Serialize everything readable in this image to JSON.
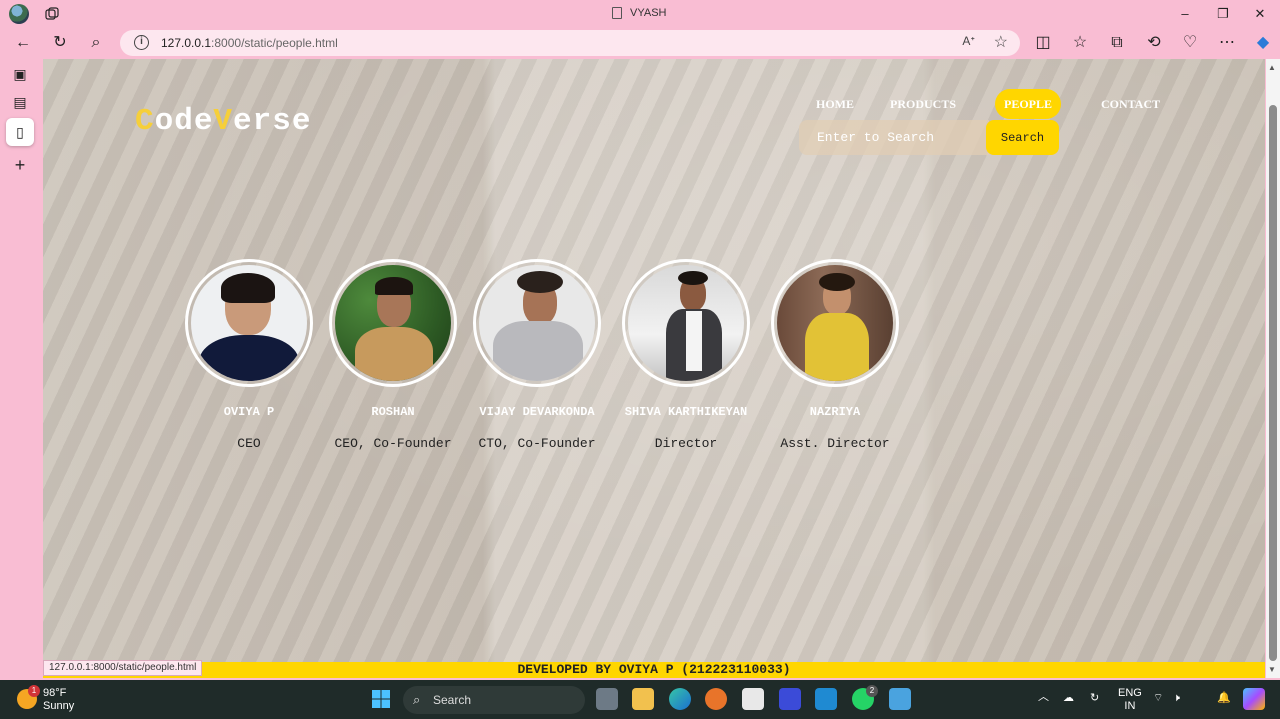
{
  "browser": {
    "tab_title": "VYASH",
    "url_host": "127.0.0.1",
    "url_rest": ":8000/static/people.html",
    "status_url": "127.0.0.1:8000/static/people.html"
  },
  "site": {
    "logo_first": "C",
    "logo_mid": "ode",
    "logo_v": "V",
    "logo_rest": "erse",
    "menu": {
      "home": "HOME",
      "products": "PRODUCTS",
      "people": "PEOPLE",
      "contact": "CONTACT"
    },
    "search": {
      "placeholder": "Enter to Search",
      "button": "Search"
    },
    "people": [
      {
        "name": "OVIYA P",
        "role": "CEO"
      },
      {
        "name": "ROSHAN",
        "role": "CEO, Co-Founder"
      },
      {
        "name": "VIJAY DEVARKONDA",
        "role": "CTO, Co-Founder"
      },
      {
        "name": "SHIVA KARTHIKEYAN",
        "role": "Director"
      },
      {
        "name": "NAZRIYA",
        "role": "Asst. Director"
      }
    ],
    "footer": "DEVELOPED BY OVIYA P (212223110033)"
  },
  "taskbar": {
    "weather_temp": "98°F",
    "weather_desc": "Sunny",
    "weather_badge": "1",
    "search_label": "Search",
    "lang_1": "ENG",
    "lang_2": "IN",
    "whatsapp_badge": "2"
  }
}
